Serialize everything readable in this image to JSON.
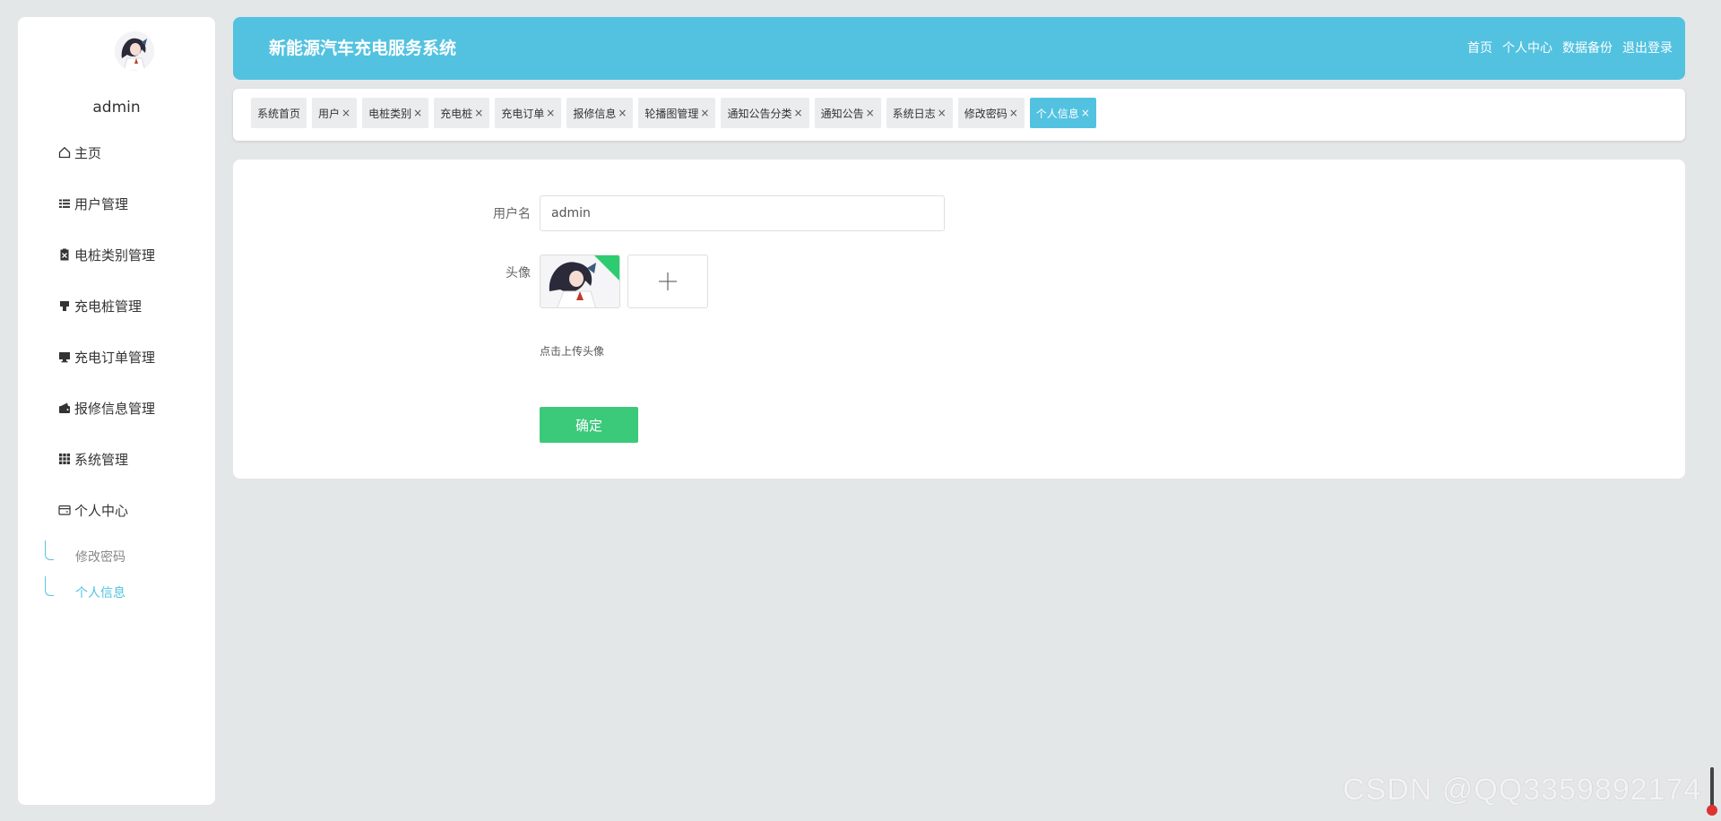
{
  "app": {
    "title": "新能源汽车充电服务系统"
  },
  "header": {
    "nav": [
      "首页",
      "个人中心",
      "数据备份",
      "退出登录"
    ]
  },
  "sidebar": {
    "username": "admin",
    "menu": [
      {
        "label": "主页",
        "icon": "home-icon"
      },
      {
        "label": "用户管理",
        "icon": "list-icon"
      },
      {
        "label": "电桩类别管理",
        "icon": "clipboard-icon"
      },
      {
        "label": "充电桩管理",
        "icon": "charger-icon"
      },
      {
        "label": "充电订单管理",
        "icon": "monitor-icon"
      },
      {
        "label": "报修信息管理",
        "icon": "wallet-icon"
      },
      {
        "label": "系统管理",
        "icon": "grid-icon"
      },
      {
        "label": "个人中心",
        "icon": "card-icon"
      }
    ],
    "submenu": [
      {
        "label": "修改密码",
        "active": false
      },
      {
        "label": "个人信息",
        "active": true
      }
    ]
  },
  "tabs": [
    {
      "label": "系统首页",
      "closable": false,
      "active": false
    },
    {
      "label": "用户",
      "closable": true,
      "active": false
    },
    {
      "label": "电桩类别",
      "closable": true,
      "active": false
    },
    {
      "label": "充电桩",
      "closable": true,
      "active": false
    },
    {
      "label": "充电订单",
      "closable": true,
      "active": false
    },
    {
      "label": "报修信息",
      "closable": true,
      "active": false
    },
    {
      "label": "轮播图管理",
      "closable": true,
      "active": false
    },
    {
      "label": "通知公告分类",
      "closable": true,
      "active": false
    },
    {
      "label": "通知公告",
      "closable": true,
      "active": false
    },
    {
      "label": "系统日志",
      "closable": true,
      "active": false
    },
    {
      "label": "修改密码",
      "closable": true,
      "active": false
    },
    {
      "label": "个人信息",
      "closable": true,
      "active": true
    }
  ],
  "form": {
    "username_label": "用户名",
    "username_value": "admin",
    "avatar_label": "头像",
    "upload_hint": "点击上传头像",
    "submit_label": "确定"
  },
  "watermark": "CSDN @QQ3359892174",
  "colors": {
    "primary": "#52c2e0",
    "success": "#3bc97a",
    "background": "#e4e7e7"
  }
}
